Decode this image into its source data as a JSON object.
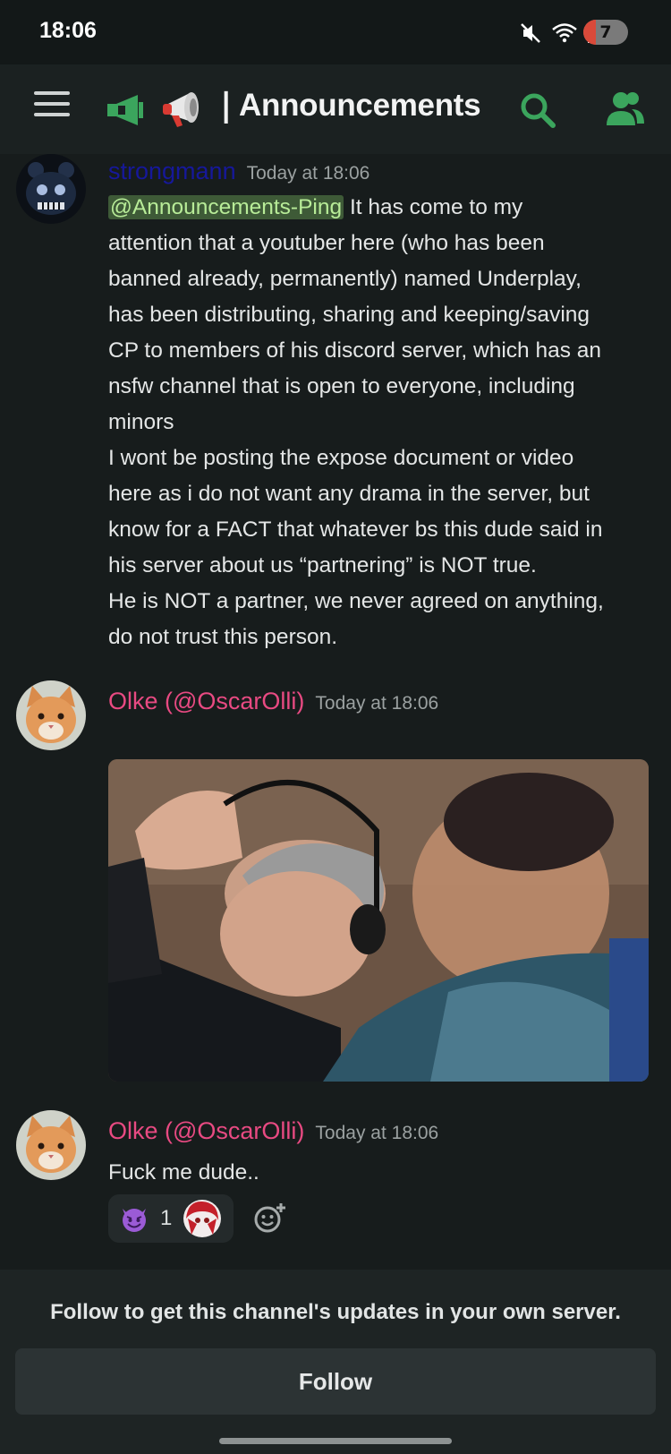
{
  "status_bar": {
    "time": "18:06",
    "battery": "7"
  },
  "header": {
    "channel_name": "❘Announcements"
  },
  "messages": [
    {
      "author": "strongmann",
      "author_color": "#16189a",
      "timestamp": "Today at 18:06",
      "mention": "@Announcements-Ping",
      "lines": [
        " It has come to my",
        "attention that a youtuber here (who has been",
        "banned already, permanently) named Underplay,",
        "has been distributing, sharing and keeping/saving",
        "CP to members of his discord server, which has an",
        "nsfw channel that is open to everyone, including",
        "minors",
        "I wont be posting the expose document or video",
        "here as i do not want any drama in the server, but",
        "know for a FACT that whatever bs this dude said in",
        "his server about us “partnering” is NOT true.",
        "He is NOT a partner, we never agreed on anything,",
        "do not trust this person."
      ]
    },
    {
      "author": "Olke (@OscarOlli)",
      "author_color": "#e84a82",
      "timestamp": "Today at 18:06",
      "attachment": "image"
    },
    {
      "author": "Olke (@OscarOlli)",
      "author_color": "#e84a82",
      "timestamp": "Today at 18:06",
      "text": "Fuck me dude..",
      "reaction": {
        "emoji": "smiling-imp-emoji",
        "count": "1"
      }
    }
  ],
  "footer": {
    "follow_prompt": "Follow to get this channel's updates in your own server.",
    "follow_label": "Follow"
  },
  "colors": {
    "accent_green": "#3ba55d",
    "mention_bg": "#3e5a37"
  }
}
